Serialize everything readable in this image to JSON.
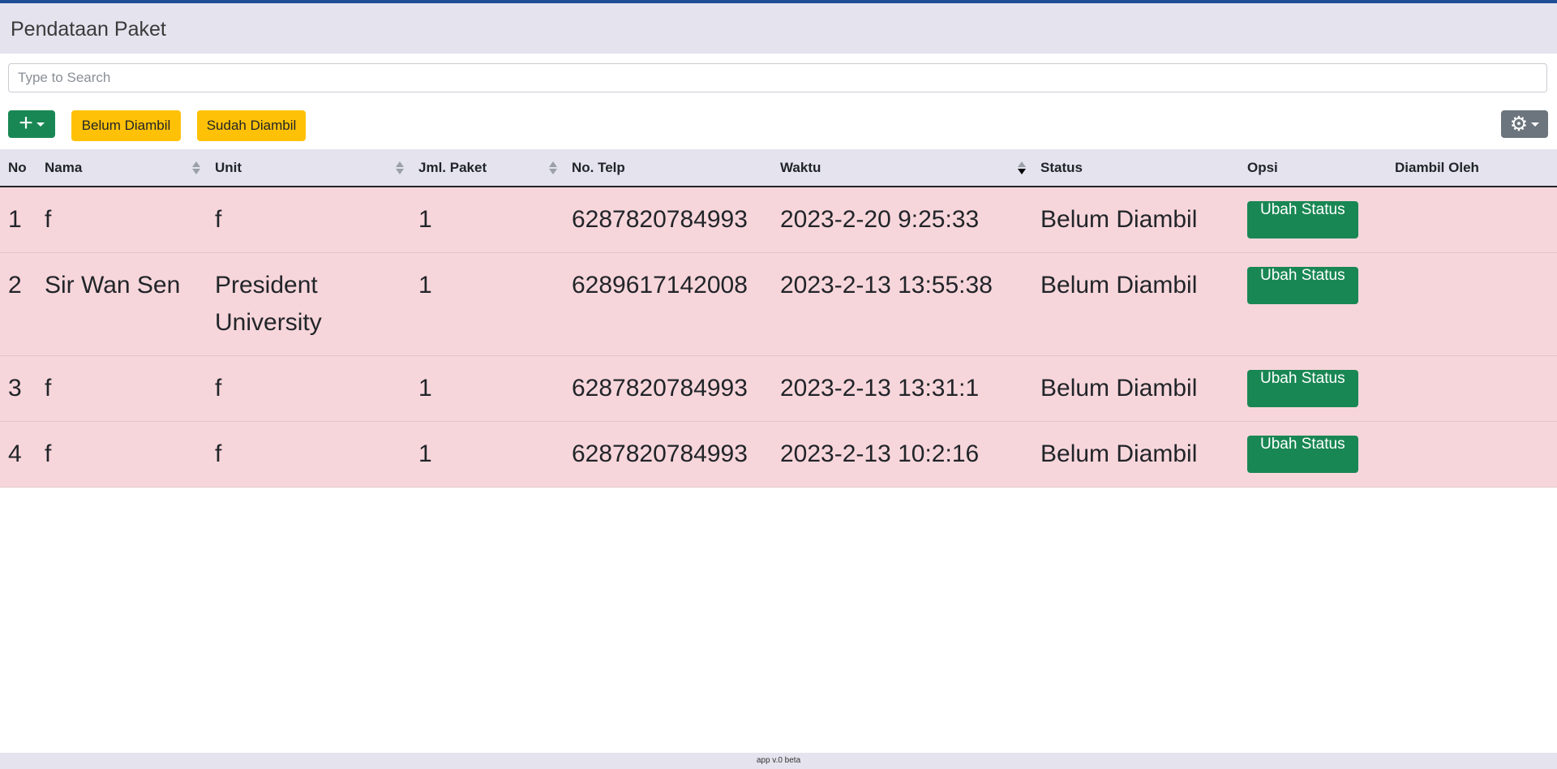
{
  "header": {
    "title": "Pendataan Paket"
  },
  "search": {
    "placeholder": "Type to Search"
  },
  "toolbar": {
    "add_icon": "plus-icon",
    "filter_belum_label": "Belum Diambil",
    "filter_sudah_label": "Sudah Diambil",
    "settings_icon": "gear-icon"
  },
  "colors": {
    "accent": "#1f4e96",
    "header_bg": "#e4e3ee",
    "success": "#198754",
    "warning": "#ffc107",
    "secondary": "#6c757d",
    "row_bg": "#f7d6db"
  },
  "table": {
    "columns": [
      "No",
      "Nama",
      "Unit",
      "Jml. Paket",
      "No. Telp",
      "Waktu",
      "Status",
      "Opsi",
      "Diambil Oleh"
    ],
    "rows": [
      {
        "no": "1",
        "nama": "f",
        "unit": "f",
        "jml": "1",
        "telp": "6287820784993",
        "waktu": "2023-2-20 9:25:33",
        "status": "Belum Diambil",
        "opsi": "Ubah Status",
        "diambil_oleh": ""
      },
      {
        "no": "2",
        "nama": "Sir Wan Sen",
        "unit": "President University",
        "jml": "1",
        "telp": "6289617142008",
        "waktu": "2023-2-13 13:55:38",
        "status": "Belum Diambil",
        "opsi": "Ubah Status",
        "diambil_oleh": ""
      },
      {
        "no": "3",
        "nama": "f",
        "unit": "f",
        "jml": "1",
        "telp": "6287820784993",
        "waktu": "2023-2-13 13:31:1",
        "status": "Belum Diambil",
        "opsi": "Ubah Status",
        "diambil_oleh": ""
      },
      {
        "no": "4",
        "nama": "f",
        "unit": "f",
        "jml": "1",
        "telp": "6287820784993",
        "waktu": "2023-2-13 10:2:16",
        "status": "Belum Diambil",
        "opsi": "Ubah Status",
        "diambil_oleh": ""
      }
    ]
  },
  "footer": {
    "version": "app v.0 beta"
  }
}
